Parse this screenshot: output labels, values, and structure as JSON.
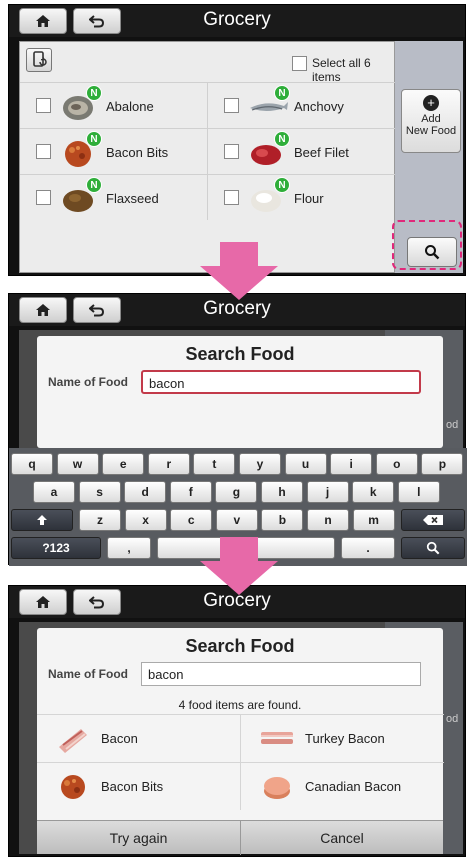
{
  "colors": {
    "badge": "#2fae3a",
    "highlight": "#e0287a",
    "arrow": "#e769a8"
  },
  "header": {
    "title": "Grocery",
    "home_icon": "home-icon",
    "back_icon": "back-icon"
  },
  "screen1": {
    "select_all_label": "Select all 6 items",
    "items": [
      {
        "name": "Abalone",
        "badge": "N"
      },
      {
        "name": "Anchovy",
        "badge": "N"
      },
      {
        "name": "Bacon Bits",
        "badge": "N"
      },
      {
        "name": "Beef Filet",
        "badge": "N"
      },
      {
        "name": "Flaxseed",
        "badge": "N"
      },
      {
        "name": "Flour",
        "badge": "N"
      }
    ],
    "add_button": {
      "line1": "Add",
      "line2": "New Food"
    }
  },
  "screen2": {
    "dialog_title": "Search Food",
    "field_label": "Name of Food",
    "field_value": "bacon",
    "bg_fragment": "od",
    "keyboard": {
      "row1": [
        "q",
        "w",
        "e",
        "r",
        "t",
        "y",
        "u",
        "i",
        "o",
        "p"
      ],
      "row2": [
        "a",
        "s",
        "d",
        "f",
        "g",
        "h",
        "j",
        "k",
        "l"
      ],
      "row3": [
        "z",
        "x",
        "c",
        "v",
        "b",
        "n",
        "m"
      ],
      "symbols_key": "?123",
      "comma_key": ",",
      "period_key": "."
    }
  },
  "screen3": {
    "dialog_title": "Search Food",
    "field_label": "Name of Food",
    "field_value": "bacon",
    "found_text": "4 food items are found.",
    "bg_fragment": "od",
    "results": [
      {
        "name": "Bacon"
      },
      {
        "name": "Turkey Bacon"
      },
      {
        "name": "Bacon Bits"
      },
      {
        "name": "Canadian Bacon"
      }
    ],
    "try_again": "Try again",
    "cancel": "Cancel"
  }
}
